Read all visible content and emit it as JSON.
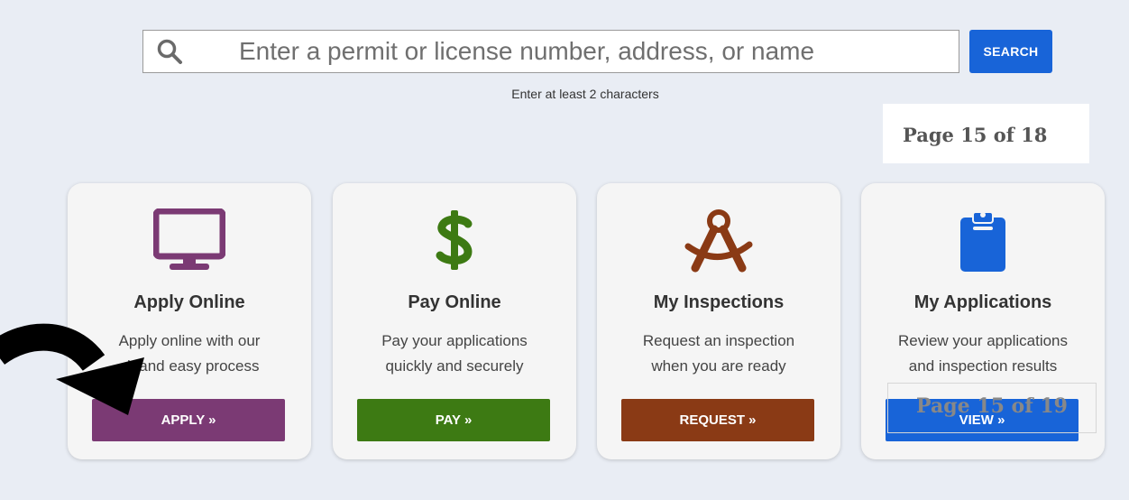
{
  "search": {
    "placeholder": "Enter a permit or license number, address, or name",
    "button_label": "SEARCH",
    "hint": "Enter at least 2 characters"
  },
  "page_labels": {
    "top": "Page 15 of 18",
    "overlay": "Page 15 of 19"
  },
  "cards": [
    {
      "title": "Apply Online",
      "desc_line1": "Apply online with our",
      "desc_line2": "ck and easy process",
      "button": "APPLY »",
      "icon": "monitor-icon",
      "color": "#7b3a74"
    },
    {
      "title": "Pay Online",
      "desc_line1": "Pay your applications",
      "desc_line2": "quickly and securely",
      "button": "PAY »",
      "icon": "dollar-icon",
      "color": "#3d7a13"
    },
    {
      "title": "My Inspections",
      "desc_line1": "Request an inspection",
      "desc_line2": "when you are ready",
      "button": "REQUEST »",
      "icon": "compass-icon",
      "color": "#8a3a15"
    },
    {
      "title": "My Applications",
      "desc_line1": "Review your applications",
      "desc_line2": "and inspection results",
      "button": "VIEW »",
      "icon": "clipboard-icon",
      "color": "#1864d8"
    }
  ],
  "colors": {
    "background": "#e9edf4",
    "search_button": "#1864d8"
  }
}
